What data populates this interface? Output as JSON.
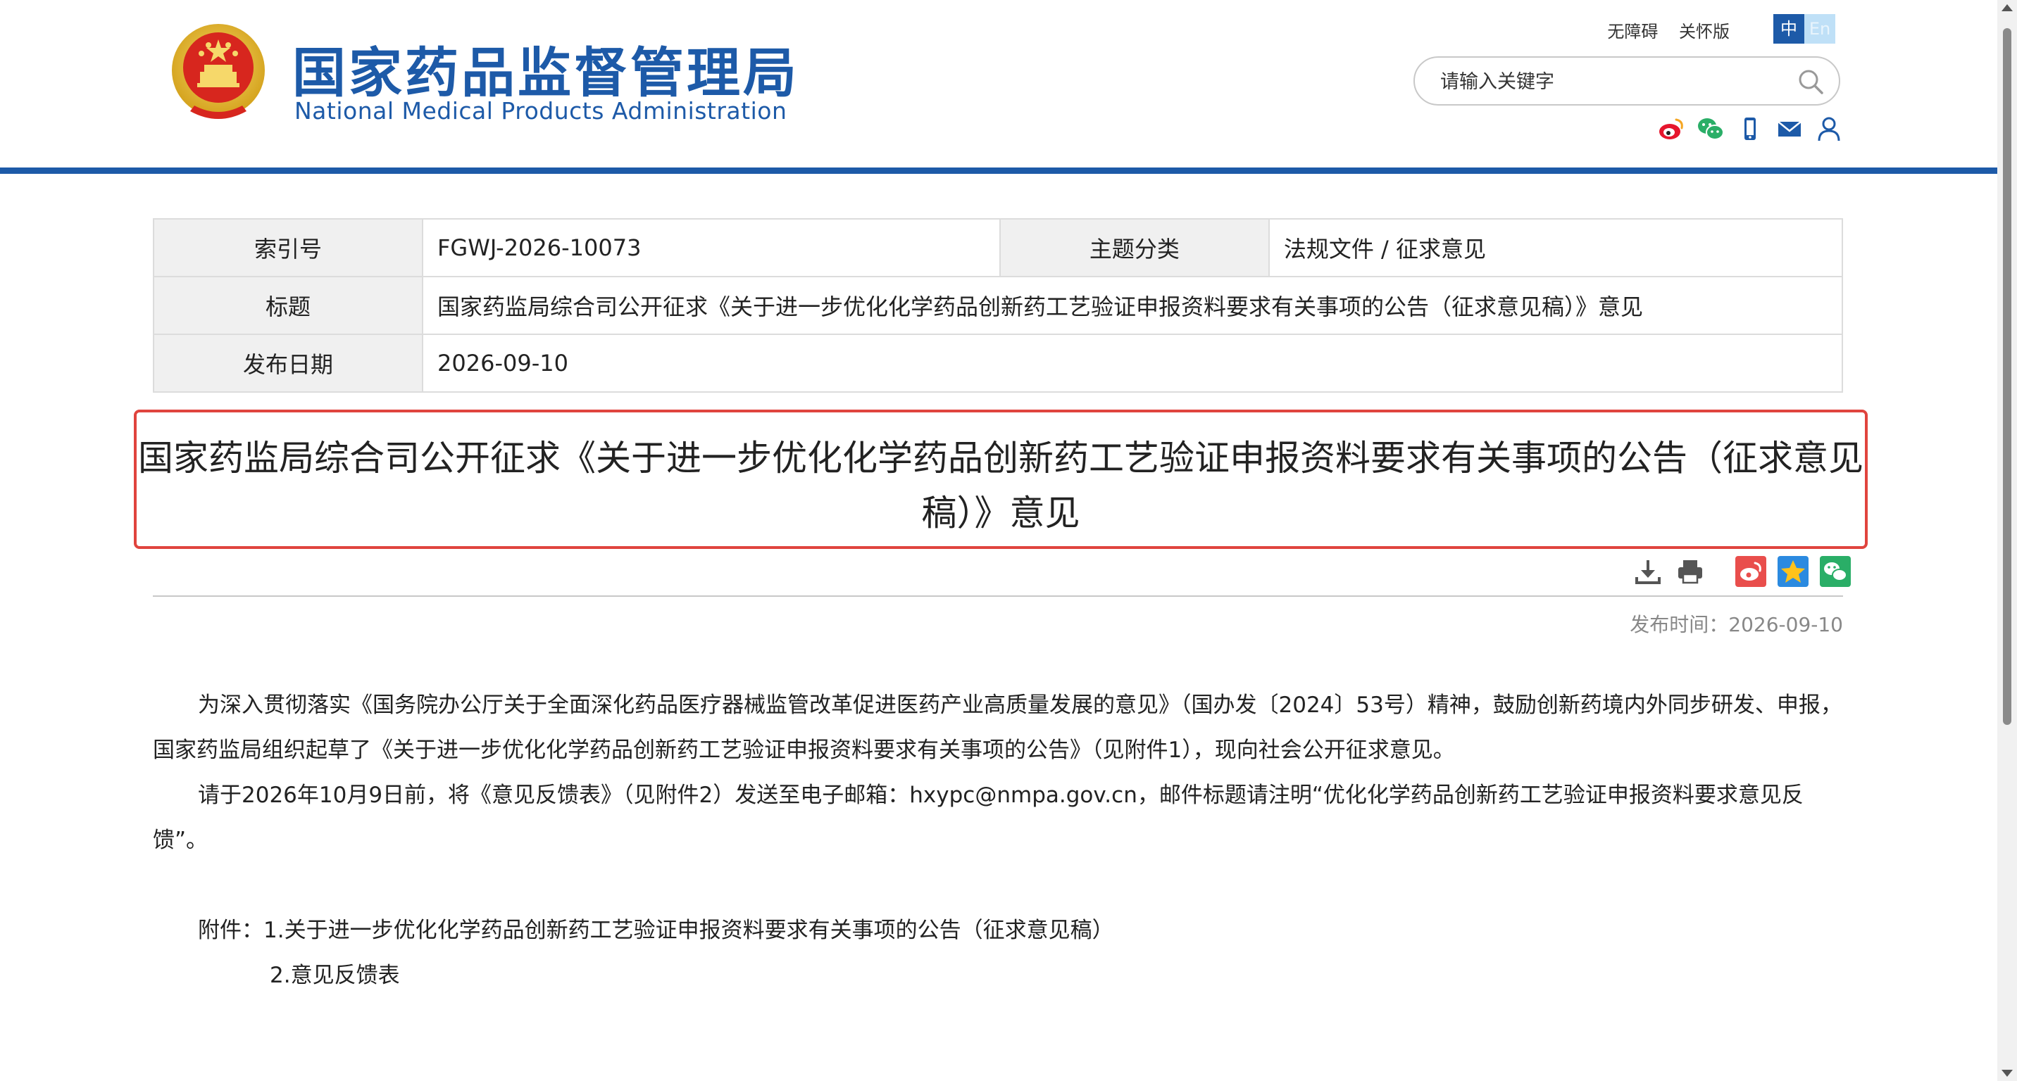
{
  "header": {
    "site_name_cn": "国家药品监督管理局",
    "site_name_en": "National Medical Products Administration",
    "accessibility": "无障碍",
    "elder_mode": "关怀版",
    "lang_zh": "中",
    "lang_en": "En",
    "search_placeholder": "请输入关键字"
  },
  "meta": {
    "index_label": "索引号",
    "index_value": "FGWJ-2026-10073",
    "topic_label": "主题分类",
    "topic_value": "法规文件 / 征求意见",
    "title_label": "标题",
    "title_value": "国家药监局综合司公开征求《关于进一步优化化学药品创新药工艺验证申报资料要求有关事项的公告（征求意见稿）》意见",
    "date_label": "发布日期",
    "date_value": "2026-09-10"
  },
  "article": {
    "title": "国家药监局综合司公开征求《关于进一步优化化学药品创新药工艺验证申报资料要求有关事项的公告（征求意见稿）》意见",
    "publish_time": "发布时间：2026-09-10",
    "para1": "为深入贯彻落实《国务院办公厅关于全面深化药品医疗器械监管改革促进医药产业高质量发展的意见》（国办发〔2024〕53号）精神，鼓励创新药境内外同步研发、申报，国家药监局组织起草了《关于进一步优化化学药品创新药工艺验证申报资料要求有关事项的公告》（见附件1），现向社会公开征求意见。",
    "para2": "请于2026年10月9日前，将《意见反馈表》（见附件2）发送至电子邮箱：hxypc@nmpa.gov.cn，邮件标题请注明“优化化学药品创新药工艺验证申报资料要求意见反馈”。",
    "attachment1": "附件：1.关于进一步优化化学药品创新药工艺验证申报资料要求有关事项的公告（征求意见稿）",
    "attachment2": "2.意见反馈表"
  },
  "colors": {
    "brand_blue": "#1d5aa8",
    "highlight_red": "#e0443e"
  }
}
